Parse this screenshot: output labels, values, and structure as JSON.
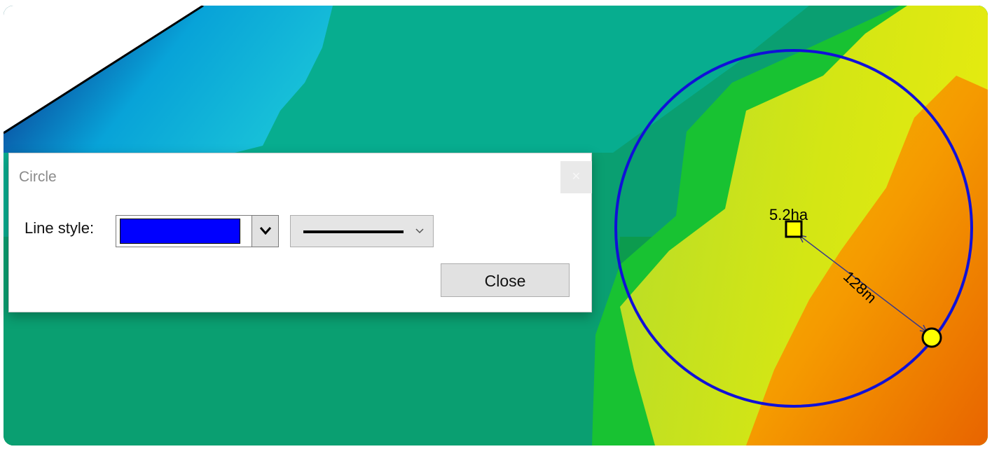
{
  "map": {
    "circle": {
      "stroke_color": "#1010d8",
      "area_label": "5.2ha",
      "radius_label": "128m",
      "center_marker_color": "#ffff00",
      "edge_handle_color": "#ffff00"
    }
  },
  "dialog": {
    "title": "Circle",
    "close_icon": "close-icon",
    "line_style_label": "Line style:",
    "color_value": "#0000ff",
    "color_dropdown_icon": "chevron-down-icon",
    "width_dropdown_icon": "chevron-down-icon",
    "close_button_label": "Close"
  }
}
